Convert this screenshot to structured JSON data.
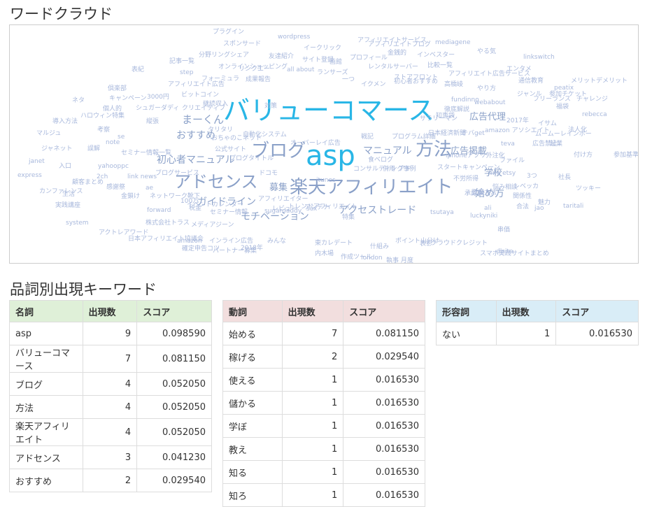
{
  "title_wordcloud": "ワードクラウド",
  "title_keywords": "品詞別出現キーワード",
  "colors": {
    "big": "#29b6e6",
    "mid": "#8aa0c8",
    "small": "#a8b8dc",
    "noun_header": "#dff0d8",
    "verb_header": "#f2dede",
    "adj_header": "#d9edf7"
  },
  "wordcloud": [
    {
      "t": "バリューコマース",
      "s": "big",
      "fs": 38
    },
    {
      "t": "asp",
      "s": "big",
      "fs": 40
    },
    {
      "t": "ブログ",
      "s": "mid",
      "fs": 26
    },
    {
      "t": "方法",
      "s": "mid",
      "fs": 26
    },
    {
      "t": "楽天アフィリエイト",
      "s": "mid",
      "fs": 26
    },
    {
      "t": "アドセンス",
      "s": "mid",
      "fs": 24
    },
    {
      "t": "まーくん",
      "s": "mid",
      "fs": 15
    },
    {
      "t": "おすすめ",
      "s": "mid",
      "fs": 14
    },
    {
      "t": "初心者マニュアル",
      "s": "mid",
      "fs": 14
    },
    {
      "t": "マニュアル",
      "s": "mid",
      "fs": 14
    },
    {
      "t": "ガイドライン",
      "s": "mid",
      "fs": 14
    },
    {
      "t": "モチベーション",
      "s": "mid",
      "fs": 14
    },
    {
      "t": "アクセストレード",
      "s": "mid",
      "fs": 14
    },
    {
      "t": "広告掲載",
      "s": "mid",
      "fs": 13
    },
    {
      "t": "広告代理",
      "s": "mid",
      "fs": 13
    },
    {
      "t": "学校",
      "s": "mid",
      "fs": 13
    },
    {
      "t": "始め方",
      "s": "mid",
      "fs": 14
    },
    {
      "t": "募集",
      "s": "mid",
      "fs": 13
    },
    {
      "t": "スポンサード",
      "s": "small",
      "fs": 9
    },
    {
      "t": "wordpress",
      "s": "small",
      "fs": 9
    },
    {
      "t": "アフィリエイトサービス",
      "s": "small",
      "fs": 9
    },
    {
      "t": "mediagene",
      "s": "small",
      "fs": 9
    },
    {
      "t": "イークリック",
      "s": "small",
      "fs": 9
    },
    {
      "t": "分野リングシェア",
      "s": "small",
      "fs": 9
    },
    {
      "t": "友達紹介",
      "s": "small",
      "fs": 9
    },
    {
      "t": "金銭的",
      "s": "small",
      "fs": 9
    },
    {
      "t": "インベスター",
      "s": "small",
      "fs": 9
    },
    {
      "t": "やる気",
      "s": "small",
      "fs": 9
    },
    {
      "t": "記事一覧",
      "s": "small",
      "fs": 9
    },
    {
      "t": "オンラインショッピング",
      "s": "small",
      "fs": 9
    },
    {
      "t": "サイト登録",
      "s": "small",
      "fs": 9
    },
    {
      "t": "画館",
      "s": "small",
      "fs": 9
    },
    {
      "t": "プロフィール",
      "s": "small",
      "fs": 9
    },
    {
      "t": "レンタルサーバー",
      "s": "small",
      "fs": 9
    },
    {
      "t": "比較一覧",
      "s": "small",
      "fs": 9
    },
    {
      "t": "エンタメ",
      "s": "small",
      "fs": 9
    },
    {
      "t": "表紀",
      "s": "small",
      "fs": 9
    },
    {
      "t": "step",
      "s": "small",
      "fs": 9
    },
    {
      "t": "all about",
      "s": "small",
      "fs": 9
    },
    {
      "t": "ランサーズ",
      "s": "small",
      "fs": 9
    },
    {
      "t": "フォーミュラ",
      "s": "small",
      "fs": 9
    },
    {
      "t": "成果報告",
      "s": "small",
      "fs": 9
    },
    {
      "t": "一つ",
      "s": "small",
      "fs": 9
    },
    {
      "t": "ストアフロント",
      "s": "small",
      "fs": 9
    },
    {
      "t": "アフィリエイト広告サービス",
      "s": "small",
      "fs": 9
    },
    {
      "t": "通信教育",
      "s": "small",
      "fs": 9
    },
    {
      "t": "メリットデメリット",
      "s": "small",
      "fs": 9
    },
    {
      "t": "アフィリエイト広告",
      "s": "small",
      "fs": 9
    },
    {
      "t": "イクメン",
      "s": "small",
      "fs": 9
    },
    {
      "t": "高橋崚",
      "s": "small",
      "fs": 9
    },
    {
      "t": "やり方",
      "s": "small",
      "fs": 9
    },
    {
      "t": "peatix",
      "s": "small",
      "fs": 9
    },
    {
      "t": "倶楽部",
      "s": "small",
      "fs": 9
    },
    {
      "t": "ビットコイン",
      "s": "small",
      "fs": 9
    },
    {
      "t": "ジャンル",
      "s": "small",
      "fs": 9
    },
    {
      "t": "フリーランス",
      "s": "small",
      "fs": 9
    },
    {
      "t": "チャレンジ",
      "s": "small",
      "fs": 9
    },
    {
      "t": "ネタ",
      "s": "small",
      "fs": 9
    },
    {
      "t": "キャンペーン",
      "s": "small",
      "fs": 9
    },
    {
      "t": "3000円",
      "s": "small",
      "fs": 9
    },
    {
      "t": "継続収入",
      "s": "small",
      "fs": 9
    },
    {
      "t": "fundinno",
      "s": "small",
      "fs": 9
    },
    {
      "t": "webabout",
      "s": "small",
      "fs": 9
    },
    {
      "t": "福袋",
      "s": "small",
      "fs": 9
    },
    {
      "t": "個人的",
      "s": "small",
      "fs": 9
    },
    {
      "t": "シュガーダディ",
      "s": "small",
      "fs": 9
    },
    {
      "t": "クリエイティブ",
      "s": "small",
      "fs": 9
    },
    {
      "t": "rebecca",
      "s": "small",
      "fs": 9
    },
    {
      "t": "ハロウィン特集",
      "s": "small",
      "fs": 9
    },
    {
      "t": "知恵袋",
      "s": "small",
      "fs": 9
    },
    {
      "t": "2017年",
      "s": "small",
      "fs": 9
    },
    {
      "t": "導入方法",
      "s": "small",
      "fs": 9
    },
    {
      "t": "縦張",
      "s": "small",
      "fs": 9
    },
    {
      "t": "徹底解説",
      "s": "small",
      "fs": 9
    },
    {
      "t": "イサム",
      "s": "small",
      "fs": 9
    },
    {
      "t": "マルジュ",
      "s": "small",
      "fs": 9
    },
    {
      "t": "考察",
      "s": "small",
      "fs": 9
    },
    {
      "t": "タリタリ",
      "s": "small",
      "fs": 9
    },
    {
      "t": "amazon アソシエイト",
      "s": "small",
      "fs": 9
    },
    {
      "t": "法人化",
      "s": "small",
      "fs": 9
    },
    {
      "t": "se",
      "s": "small",
      "fs": 9
    },
    {
      "t": "おちゃのこネット",
      "s": "small",
      "fs": 9
    },
    {
      "t": "自動化システム",
      "s": "small",
      "fs": 9
    },
    {
      "t": "日本経済新聞",
      "s": "small",
      "fs": 9
    },
    {
      "t": "テバget",
      "s": "small",
      "fs": 9
    },
    {
      "t": "ムームーレインボー",
      "s": "small",
      "fs": 9
    },
    {
      "t": "note",
      "s": "small",
      "fs": 9
    },
    {
      "t": "戦記",
      "s": "small",
      "fs": 9
    },
    {
      "t": "プログラム詳細",
      "s": "small",
      "fs": 9
    },
    {
      "t": "teva",
      "s": "small",
      "fs": 9
    },
    {
      "t": "広告禁止",
      "s": "small",
      "fs": 9
    },
    {
      "t": "起業",
      "s": "small",
      "fs": 9
    },
    {
      "t": "ジャネット",
      "s": "small",
      "fs": 9
    },
    {
      "t": "誤解",
      "s": "small",
      "fs": 9
    },
    {
      "t": "セミナー情報一覧",
      "s": "small",
      "fs": 9
    },
    {
      "t": "公式サイト",
      "s": "small",
      "fs": 9
    },
    {
      "t": "付け方",
      "s": "small",
      "fs": 9
    },
    {
      "t": "参加基準",
      "s": "small",
      "fs": 9
    },
    {
      "t": "janet",
      "s": "small",
      "fs": 9
    },
    {
      "t": "プログタイトル",
      "s": "small",
      "fs": 9
    },
    {
      "t": "食べログ",
      "s": "small",
      "fs": 9
    },
    {
      "t": "ファイル",
      "s": "small",
      "fs": 9
    },
    {
      "t": "入口",
      "s": "small",
      "fs": 9
    },
    {
      "t": "yahooppc",
      "s": "small",
      "fs": 9
    },
    {
      "t": "スタートキャンペーン",
      "s": "small",
      "fs": 9
    },
    {
      "t": "express",
      "s": "small",
      "fs": 9
    },
    {
      "t": "ブログサービス",
      "s": "small",
      "fs": 9
    },
    {
      "t": "ドコモ",
      "s": "small",
      "fs": 9
    },
    {
      "t": "コンサルティング事例",
      "s": "small",
      "fs": 9
    },
    {
      "t": "併用",
      "s": "small",
      "fs": 9
    },
    {
      "t": "アド",
      "s": "small",
      "fs": 9
    },
    {
      "t": "line etsy",
      "s": "small",
      "fs": 9
    },
    {
      "t": "2ch",
      "s": "small",
      "fs": 9
    },
    {
      "t": "link news",
      "s": "small",
      "fs": 9
    },
    {
      "t": "3つ",
      "s": "small",
      "fs": 9
    },
    {
      "t": "社長",
      "s": "small",
      "fs": 9
    },
    {
      "t": "顧客まとめ",
      "s": "small",
      "fs": 9
    },
    {
      "t": "不労所得",
      "s": "small",
      "fs": 9
    },
    {
      "t": "カンファレンス",
      "s": "small",
      "fs": 9
    },
    {
      "t": "感謝祭",
      "s": "small",
      "fs": 9
    },
    {
      "t": "ae",
      "s": "small",
      "fs": 9
    },
    {
      "t": "悩み相談",
      "s": "small",
      "fs": 9
    },
    {
      "t": "レベッカ",
      "s": "small",
      "fs": 9
    },
    {
      "t": "ツッキー",
      "s": "small",
      "fs": 9
    },
    {
      "t": "生活",
      "s": "small",
      "fs": 9
    },
    {
      "t": "金鎖け",
      "s": "small",
      "fs": 9
    },
    {
      "t": "ネットワーク靴下",
      "s": "small",
      "fs": 9
    },
    {
      "t": "アフィリエイター",
      "s": "small",
      "fs": 9
    },
    {
      "t": "承認率",
      "s": "small",
      "fs": 9
    },
    {
      "t": "関係性",
      "s": "small",
      "fs": 9
    },
    {
      "t": "100万",
      "s": "small",
      "fs": 9
    },
    {
      "t": "魅力",
      "s": "small",
      "fs": 9
    },
    {
      "t": "実践講座",
      "s": "small",
      "fs": 9
    },
    {
      "t": "forward",
      "s": "small",
      "fs": 9
    },
    {
      "t": "税金",
      "s": "small",
      "fs": 9
    },
    {
      "t": "レビュー",
      "s": "small",
      "fs": 9
    },
    {
      "t": "トレンドアフィリエイト",
      "s": "small",
      "fs": 9
    },
    {
      "t": "アンテナ",
      "s": "small",
      "fs": 9
    },
    {
      "t": "ali",
      "s": "small",
      "fs": 9
    },
    {
      "t": "合法",
      "s": "small",
      "fs": 9
    },
    {
      "t": "jao",
      "s": "small",
      "fs": 9
    },
    {
      "t": "taritali",
      "s": "small",
      "fs": 9
    },
    {
      "t": "system",
      "s": "small",
      "fs": 9
    },
    {
      "t": "株式会社トラス",
      "s": "small",
      "fs": 9
    },
    {
      "t": "メディアジーン",
      "s": "small",
      "fs": 9
    },
    {
      "t": "セミナー情報",
      "s": "small",
      "fs": 9
    },
    {
      "t": "sugardaddy",
      "s": "small",
      "fs": 9
    },
    {
      "t": "sox",
      "s": "small",
      "fs": 9
    },
    {
      "t": "tsutaya",
      "s": "small",
      "fs": 9
    },
    {
      "t": "luckyniki",
      "s": "small",
      "fs": 9
    },
    {
      "t": "アクトレアワード",
      "s": "small",
      "fs": 9
    },
    {
      "t": "日本アフィリエイト協議会",
      "s": "small",
      "fs": 9
    },
    {
      "t": "amazon",
      "s": "small",
      "fs": 9
    },
    {
      "t": "インライン広告",
      "s": "small",
      "fs": 9
    },
    {
      "t": "みんな",
      "s": "small",
      "fs": 9
    },
    {
      "t": "東カレデート",
      "s": "small",
      "fs": 9
    },
    {
      "t": "什組み",
      "s": "small",
      "fs": 9
    },
    {
      "t": "ポイント山分け",
      "s": "small",
      "fs": 9
    },
    {
      "t": "表彰",
      "s": "small",
      "fs": 9
    },
    {
      "t": "クラウドクレジット",
      "s": "small",
      "fs": 9
    },
    {
      "t": "スマホ実践サイトまとめ",
      "s": "small",
      "fs": 9
    },
    {
      "t": "dlsite",
      "s": "small",
      "fs": 9
    },
    {
      "t": "確定申告コツ",
      "s": "small",
      "fs": 9
    },
    {
      "t": "パートナー募集",
      "s": "small",
      "fs": 9
    },
    {
      "t": "2018年",
      "s": "small",
      "fs": 9
    },
    {
      "t": "内木場",
      "s": "small",
      "fs": 9
    },
    {
      "t": "作成ツール",
      "s": "small",
      "fs": 9
    },
    {
      "t": "london",
      "s": "small",
      "fs": 9
    },
    {
      "t": "執事 月度",
      "s": "small",
      "fs": 9
    },
    {
      "t": "イベントカレンダー",
      "s": "small",
      "fs": 9
    },
    {
      "t": "プラグイン",
      "s": "small",
      "fs": 9
    },
    {
      "t": "リンクエー",
      "s": "small",
      "fs": 9
    },
    {
      "t": "対策",
      "s": "small",
      "fs": 9
    },
    {
      "t": "オーバーレイ広告",
      "s": "small",
      "fs": 9
    },
    {
      "t": "itunes",
      "s": "small",
      "fs": 9
    },
    {
      "t": "特集",
      "s": "small",
      "fs": 9
    },
    {
      "t": "アフィリエイトブログ",
      "s": "small",
      "fs": 9
    },
    {
      "t": "初心者おすすめ",
      "s": "small",
      "fs": 9
    },
    {
      "t": "サラリーマン",
      "s": "small",
      "fs": 9
    },
    {
      "t": "iphoneアプリ外注化",
      "s": "small",
      "fs": 9
    },
    {
      "t": "登録方法",
      "s": "small",
      "fs": 9
    },
    {
      "t": "串価",
      "s": "small",
      "fs": 9
    },
    {
      "t": "linkswitch",
      "s": "small",
      "fs": 9
    },
    {
      "t": "参加チケット",
      "s": "small",
      "fs": 9
    }
  ],
  "tables": {
    "noun": {
      "headers": [
        "名詞",
        "出現数",
        "スコア"
      ],
      "rows": [
        [
          "asp",
          "9",
          "0.098590"
        ],
        [
          "バリューコマース",
          "7",
          "0.081150"
        ],
        [
          "ブログ",
          "4",
          "0.052050"
        ],
        [
          "方法",
          "4",
          "0.052050"
        ],
        [
          "楽天アフィリエイト",
          "4",
          "0.052050"
        ],
        [
          "アドセンス",
          "3",
          "0.041230"
        ],
        [
          "おすすめ",
          "2",
          "0.029540"
        ]
      ]
    },
    "verb": {
      "headers": [
        "動詞",
        "出現数",
        "スコア"
      ],
      "rows": [
        [
          "始める",
          "7",
          "0.081150"
        ],
        [
          "稼げる",
          "2",
          "0.029540"
        ],
        [
          "使える",
          "1",
          "0.016530"
        ],
        [
          "儲かる",
          "1",
          "0.016530"
        ],
        [
          "学ぼ",
          "1",
          "0.016530"
        ],
        [
          "教え",
          "1",
          "0.016530"
        ],
        [
          "知る",
          "1",
          "0.016530"
        ],
        [
          "知ろ",
          "1",
          "0.016530"
        ]
      ]
    },
    "adj": {
      "headers": [
        "形容詞",
        "出現数",
        "スコア"
      ],
      "rows": [
        [
          "ない",
          "1",
          "0.016530"
        ]
      ]
    }
  }
}
